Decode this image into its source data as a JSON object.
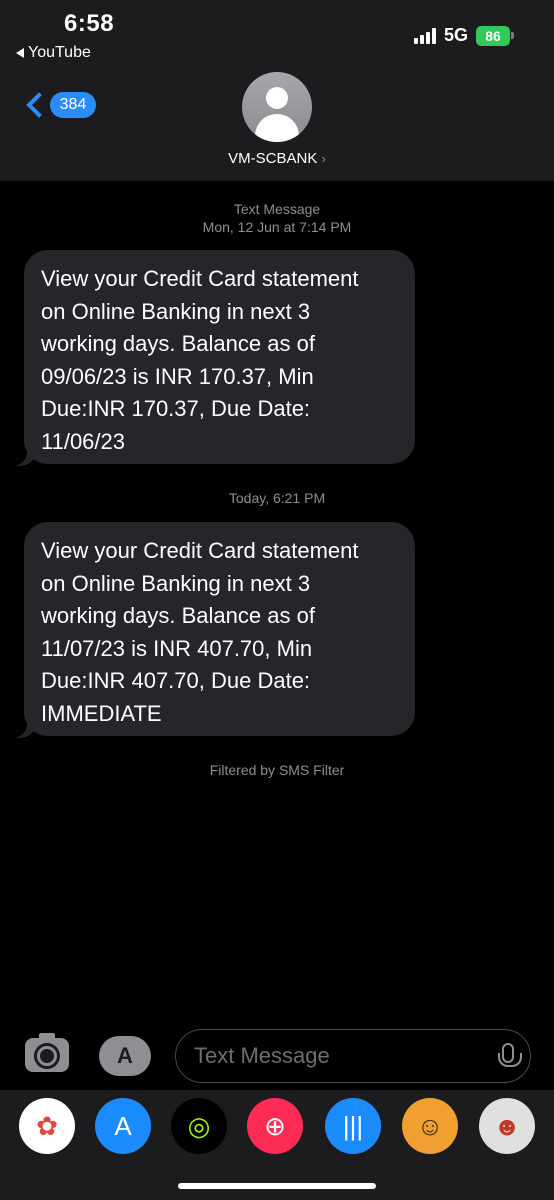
{
  "status_bar": {
    "time": "6:58",
    "back_app": "YouTube",
    "network": "5G",
    "battery": "86"
  },
  "nav": {
    "unread_count": "384",
    "contact_name": "VM-SCBANK",
    "contact_chevron": "›"
  },
  "messages": [
    {
      "type_label": "Text Message",
      "timestamp": "Mon, 12 Jun at 7:14 PM",
      "text": "View your Credit Card statement\non Online Banking in next 3\nworking days. Balance as of\n09/06/23 is INR  170.37, Min\nDue:INR 170.37, Due Date:\n11/06/23"
    },
    {
      "timestamp": "Today, 6:21 PM",
      "text": "View your Credit Card statement\non Online Banking in next 3\nworking days. Balance as of\n11/07/23 is INR  407.70, Min\nDue:INR 407.70, Due Date:\nIMMEDIATE"
    }
  ],
  "filter_note": "Filtered by SMS Filter",
  "composer": {
    "placeholder": "Text Message",
    "apps_glyph": "A"
  },
  "app_drawer": [
    {
      "name": "photos-app-icon",
      "glyph": "✿",
      "bg": "#ffffff",
      "fg": "#e8453c"
    },
    {
      "name": "app-store-app-icon",
      "glyph": "A",
      "bg": "#1a8cff",
      "fg": "#ffffff"
    },
    {
      "name": "fitness-app-icon",
      "glyph": "◎",
      "bg": "#000000",
      "fg": "#a6ff00"
    },
    {
      "name": "search-images-app-icon",
      "glyph": "⊕",
      "bg": "#ff2d55",
      "fg": "#ffffff"
    },
    {
      "name": "audio-message-app-icon",
      "glyph": "|||",
      "bg": "#1a8cff",
      "fg": "#ffffff"
    },
    {
      "name": "memoji-app-icon",
      "glyph": "☺",
      "bg": "#f0a030",
      "fg": "#3a2a10"
    },
    {
      "name": "memoji-stickers-app-icon",
      "glyph": "☻",
      "bg": "#e0e0e0",
      "fg": "#c0392b"
    }
  ]
}
